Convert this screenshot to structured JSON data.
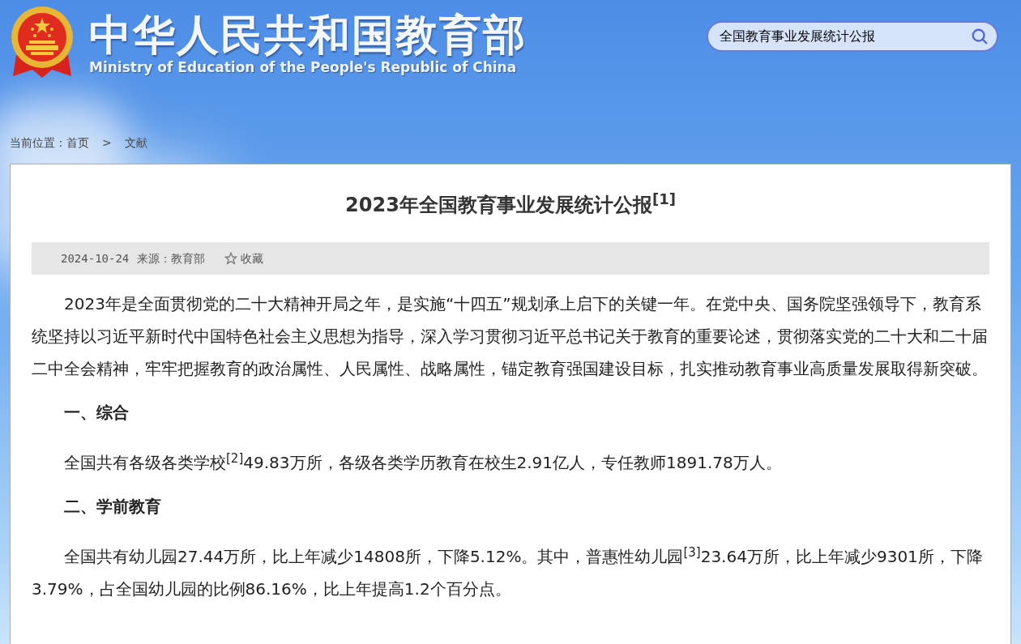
{
  "header": {
    "title": "中华人民共和国教育部",
    "subtitle": "Ministry of Education of the People's Republic of China",
    "search": {
      "value": "全国教育事业发展统计公报"
    }
  },
  "breadcrumb": {
    "label": "当前位置：",
    "items": [
      "首页",
      "文献"
    ],
    "separator": ">"
  },
  "article": {
    "title": "2023年全国教育事业发展统计公报$^{[1]}$",
    "date": "2024-10-24",
    "source": "来源：教育部",
    "favorite": "收藏",
    "blocks": [
      {
        "kind": "paragraph",
        "text": "2023年是全面贯彻党的二十大精神开局之年，是实施“十四五”规划承上启下的关键一年。在党中央、国务院坚强领导下，教育系统坚持以习近平新时代中国特色社会主义思想为指导，深入学习贯彻习近平总书记关于教育的重要论述，贯彻落实党的二十大和二十届二中全会精神，牢牢把握教育的政治属性、人民属性、战略属性，锚定教育强国建设目标，扎实推动教育事业高质量发展取得新突破。"
      },
      {
        "kind": "heading",
        "text": "一、综合"
      },
      {
        "kind": "paragraph",
        "text": "全国共有各级各类学校$^{[2]}$49.83万所，各级各类学历教育在校生2.91亿人，专任教师1891.78万人。"
      },
      {
        "kind": "heading",
        "text": "二、学前教育"
      },
      {
        "kind": "paragraph",
        "text": "全国共有幼儿园27.44万所，比上年减少14808所，下降5.12%。其中，普惠性幼儿园$^{[3]}$23.64万所，比上年减少9301所，下降3.79%，占全国幼儿园的比例86.16%，比上年提高1.2个百分点。"
      }
    ]
  }
}
